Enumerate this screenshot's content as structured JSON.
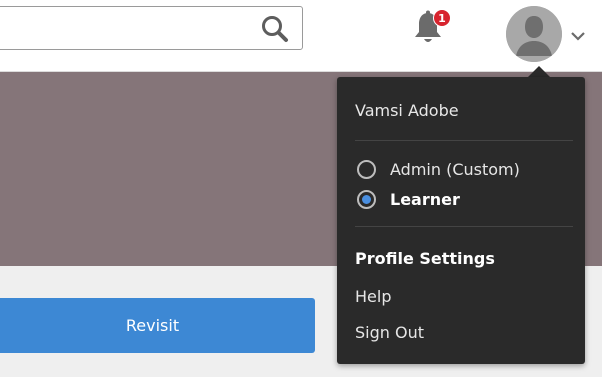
{
  "header": {
    "search": {
      "value": "",
      "placeholder": ""
    },
    "notifications": {
      "count": "1"
    }
  },
  "banner": {
    "color": "#857579"
  },
  "content": {
    "revisit_label": "Revisit"
  },
  "user_menu": {
    "user_name": "Vamsi Adobe",
    "roles": [
      {
        "label": "Admin (Custom)",
        "selected": false
      },
      {
        "label": "Learner",
        "selected": true
      }
    ],
    "links": {
      "profile_settings": "Profile Settings",
      "help": "Help",
      "sign_out": "Sign Out"
    }
  },
  "colors": {
    "accent": "#3d88d4",
    "badge": "#d7242e",
    "menu_bg": "#2a2a2a",
    "radio_selected": "#4a8fe0"
  }
}
